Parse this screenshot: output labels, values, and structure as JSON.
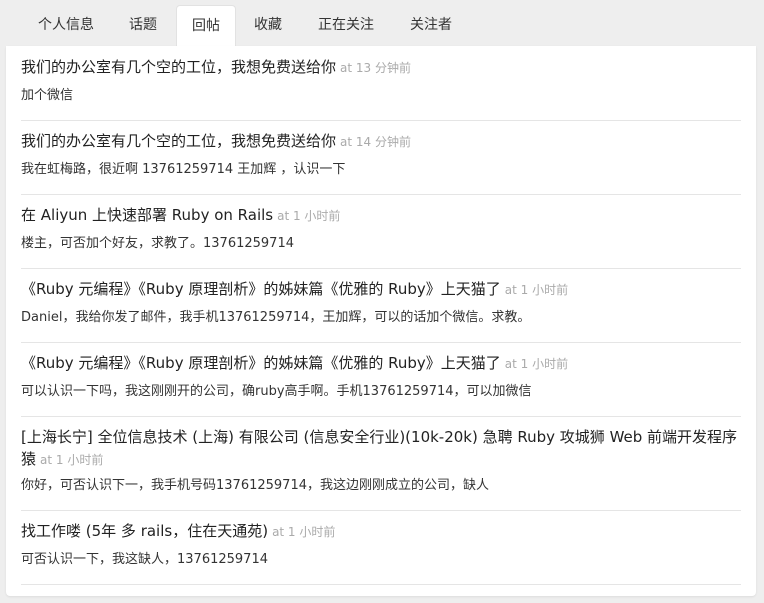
{
  "tabs": [
    {
      "label": "个人信息"
    },
    {
      "label": "话题"
    },
    {
      "label": "回帖",
      "active": true
    },
    {
      "label": "收藏"
    },
    {
      "label": "正在关注"
    },
    {
      "label": "关注者"
    }
  ],
  "replies": [
    {
      "title": "我们的办公室有几个空的工位，我想免费送给你",
      "time": "at 13 分钟前",
      "body": "加个微信"
    },
    {
      "title": "我们的办公室有几个空的工位，我想免费送给你",
      "time": "at 14 分钟前",
      "body": "我在虹梅路，很近啊 13761259714 王加辉 ，认识一下"
    },
    {
      "title": "在 Aliyun 上快速部署 Ruby on Rails",
      "time": "at 1 小时前",
      "body": "楼主，可否加个好友，求教了。13761259714"
    },
    {
      "title": "《Ruby 元编程》《Ruby 原理剖析》的姊妹篇《优雅的 Ruby》上天猫了",
      "time": "at 1 小时前",
      "body": "Daniel，我给你发了邮件，我手机13761259714，王加辉，可以的话加个微信。求教。"
    },
    {
      "title": "《Ruby 元编程》《Ruby 原理剖析》的姊妹篇《优雅的 Ruby》上天猫了",
      "time": "at 1 小时前",
      "body": "可以认识一下吗，我这刚刚开的公司，确ruby高手啊。手机13761259714，可以加微信"
    },
    {
      "title": "[上海长宁] 全位信息技术 (上海) 有限公司 (信息安全行业)(10k-20k) 急聘 Ruby 攻城狮 Web 前端开发程序猿",
      "time": "at 1 小时前",
      "body": "你好，可否认识下一，我手机号码13761259714，我这边刚刚成立的公司，缺人"
    },
    {
      "title": "找工作喽 (5年 多 rails，住在天通苑)",
      "time": "at 1 小时前",
      "body": "可否认识一下，我这缺人，13761259714"
    }
  ]
}
